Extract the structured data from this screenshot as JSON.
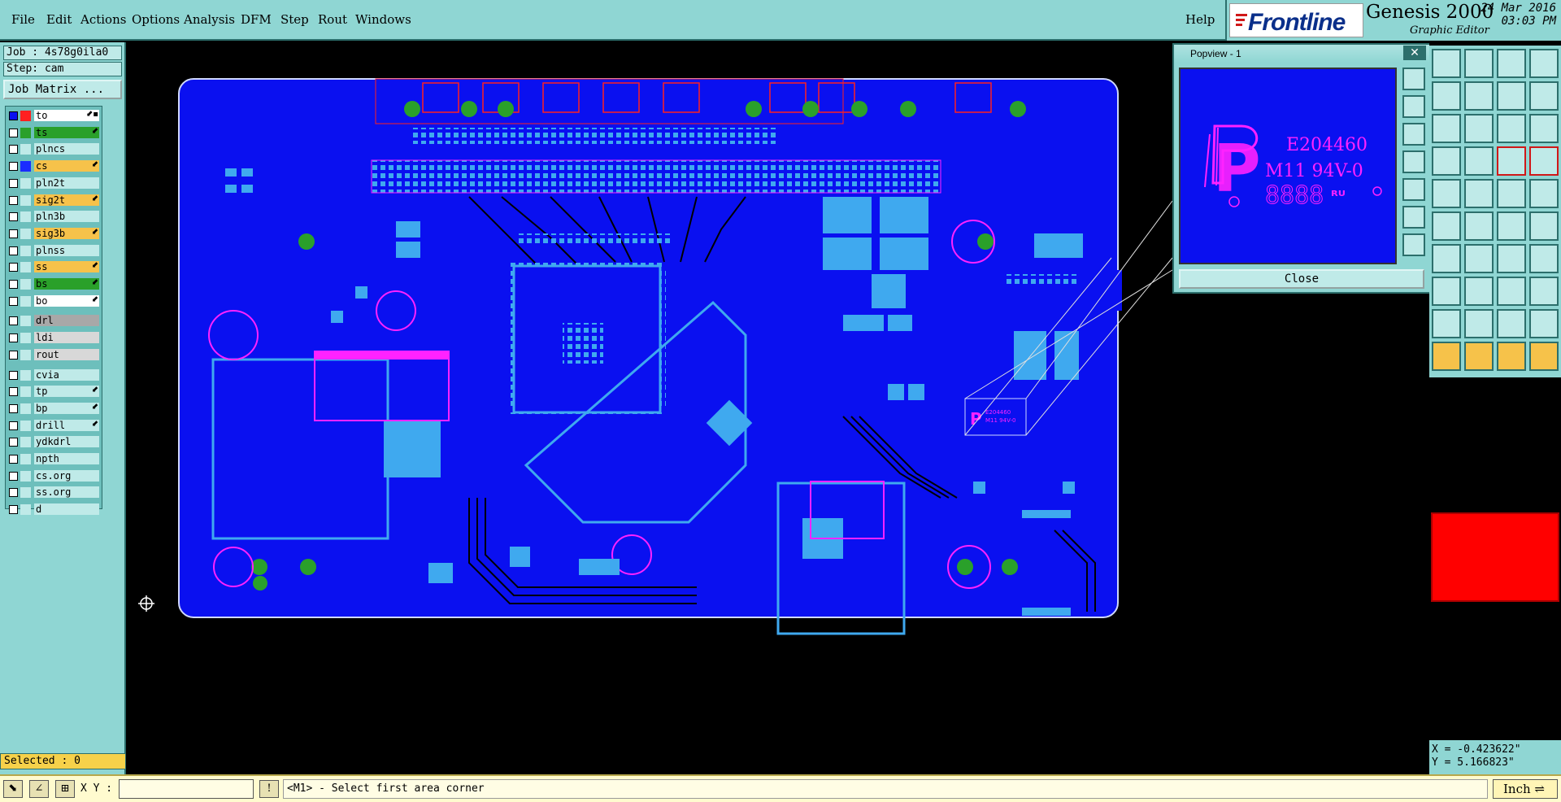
{
  "menu": {
    "items": [
      "File",
      "Edit",
      "Actions",
      "Options",
      "Analysis",
      "DFM",
      "Step",
      "Rout",
      "Windows"
    ],
    "help": "Help"
  },
  "branding": {
    "vendor": "Frontline",
    "product": "Genesis 2000",
    "subtitle": "Graphic Editor",
    "date": "24 Mar 2016",
    "time": "03:03 PM"
  },
  "job": {
    "job_line": "Job : 4s78g0ila0",
    "step_line": "Step: cam",
    "matrix_button": "Job Matrix ..."
  },
  "layers": [
    {
      "name": "to",
      "color": "#ff2020",
      "bg": "#ffffff",
      "checked": true,
      "flag": "⬋▪"
    },
    {
      "name": "ts",
      "color": "#2aa02a",
      "bg": "#2aa02a",
      "checked": false,
      "flag": "⬋"
    },
    {
      "name": "plncs",
      "color": "#bfeae8",
      "bg": "#bfeae8",
      "checked": false,
      "flag": ""
    },
    {
      "name": "cs",
      "color": "#1a2cff",
      "bg": "#f6c24a",
      "checked": false,
      "flag": "⬋"
    },
    {
      "name": "pln2t",
      "color": "#bfeae8",
      "bg": "#bfeae8",
      "checked": false,
      "flag": ""
    },
    {
      "name": "sig2t",
      "color": "#bfeae8",
      "bg": "#f6c24a",
      "checked": false,
      "flag": "⬋"
    },
    {
      "name": "pln3b",
      "color": "#bfeae8",
      "bg": "#bfeae8",
      "checked": false,
      "flag": ""
    },
    {
      "name": "sig3b",
      "color": "#bfeae8",
      "bg": "#f6c24a",
      "checked": false,
      "flag": "⬋"
    },
    {
      "name": "plnss",
      "color": "#bfeae8",
      "bg": "#bfeae8",
      "checked": false,
      "flag": ""
    },
    {
      "name": "ss",
      "color": "#bfeae8",
      "bg": "#f6c24a",
      "checked": false,
      "flag": "⬋"
    },
    {
      "name": "bs",
      "color": "#bfeae8",
      "bg": "#2aa02a",
      "checked": false,
      "flag": "⬋"
    },
    {
      "name": "bo",
      "color": "#bfeae8",
      "bg": "#ffffff",
      "checked": false,
      "flag": "⬋"
    },
    {
      "name": "drl",
      "color": "#bfeae8",
      "bg": "#a8a8a8",
      "checked": false,
      "flag": ""
    },
    {
      "name": "ldi",
      "color": "#bfeae8",
      "bg": "#d8d8d8",
      "checked": false,
      "flag": ""
    },
    {
      "name": "rout",
      "color": "#bfeae8",
      "bg": "#d8d8d8",
      "checked": false,
      "flag": ""
    },
    {
      "name": "cvia",
      "color": "#bfeae8",
      "bg": "#bfeae8",
      "checked": false,
      "flag": ""
    },
    {
      "name": "tp",
      "color": "#bfeae8",
      "bg": "#bfeae8",
      "checked": false,
      "flag": "⬋"
    },
    {
      "name": "bp",
      "color": "#bfeae8",
      "bg": "#bfeae8",
      "checked": false,
      "flag": "⬋"
    },
    {
      "name": "drill",
      "color": "#bfeae8",
      "bg": "#bfeae8",
      "checked": false,
      "flag": "⬋"
    },
    {
      "name": "ydkdrl",
      "color": "#bfeae8",
      "bg": "#bfeae8",
      "checked": false,
      "flag": ""
    },
    {
      "name": "npth",
      "color": "#bfeae8",
      "bg": "#bfeae8",
      "checked": false,
      "flag": ""
    },
    {
      "name": "cs.org",
      "color": "#bfeae8",
      "bg": "#bfeae8",
      "checked": false,
      "flag": ""
    },
    {
      "name": "ss.org",
      "color": "#bfeae8",
      "bg": "#bfeae8",
      "checked": false,
      "flag": ""
    },
    {
      "name": "d",
      "color": "#bfeae8",
      "bg": "#bfeae8",
      "checked": false,
      "flag": ""
    }
  ],
  "status": {
    "selected": "Selected : 0",
    "xy_label": "X Y :",
    "xy_value": "",
    "prompt": "<M1> - Select first area corner",
    "unit": "Inch"
  },
  "coords": {
    "x": "X = -0.423622\"",
    "y": "Y = 5.166823\""
  },
  "popview": {
    "title": "Popview - 1",
    "close_button": "Close",
    "marking_line1": "E204460",
    "marking_line2": "M11 94V-0",
    "marking_digits": "8888",
    "small_line1": "E204460",
    "small_line2": "M11 94V-0"
  },
  "colors": {
    "board_blue": "#0a10f0",
    "trace_light": "#3fa9ef",
    "magenta": "#ff22ff",
    "copper_red": "#ff2020",
    "panel_teal": "#8fd6d3",
    "active_swatch": "#ff0000"
  },
  "icons": {
    "toolbar": [
      "zoom-home-icon",
      "zoom-in-icon",
      "zoom-out-icon",
      "pan-icon",
      "measure-icon",
      "snap-icon",
      "grid-icon",
      "select-icon"
    ]
  }
}
